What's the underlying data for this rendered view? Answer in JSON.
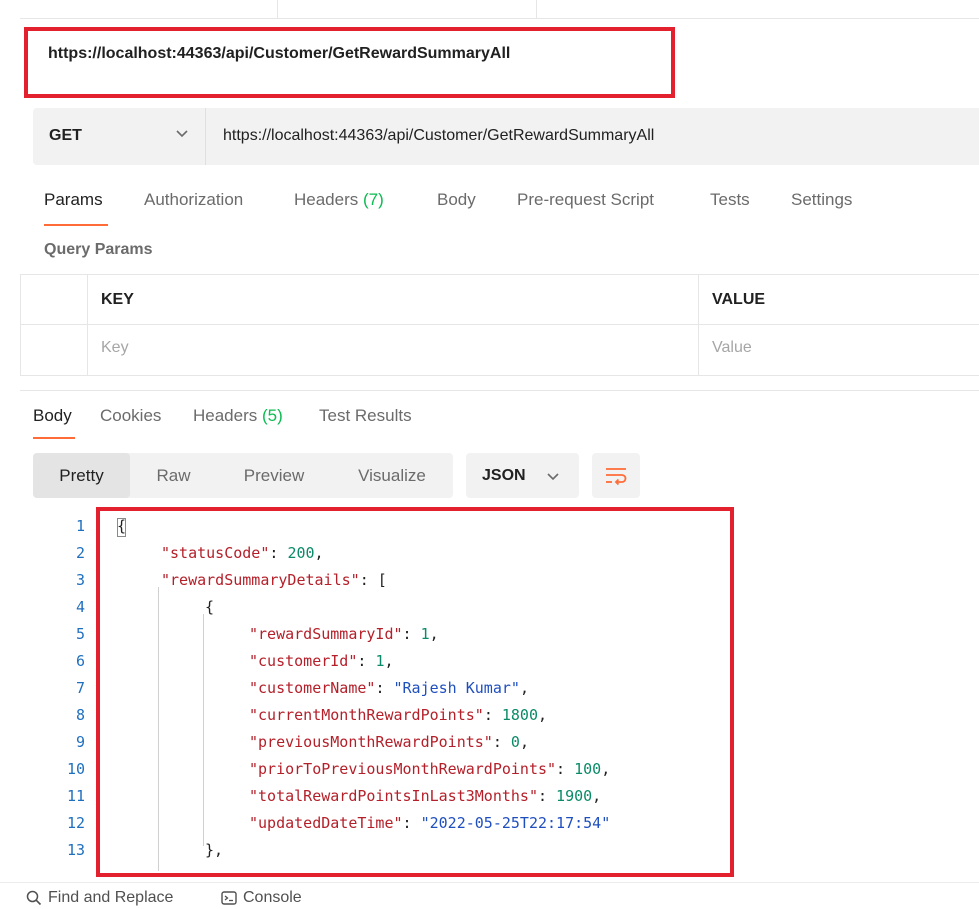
{
  "title_bar": {
    "url": "https://localhost:44363/api/Customer/GetRewardSummaryAll"
  },
  "request": {
    "method": "GET",
    "url": "https://localhost:44363/api/Customer/GetRewardSummaryAll",
    "tabs": [
      {
        "label": "Params",
        "count": ""
      },
      {
        "label": "Authorization",
        "count": ""
      },
      {
        "label": "Headers",
        "count": "(7)"
      },
      {
        "label": "Body",
        "count": ""
      },
      {
        "label": "Pre-request Script",
        "count": ""
      },
      {
        "label": "Tests",
        "count": ""
      },
      {
        "label": "Settings",
        "count": ""
      }
    ],
    "active_tab": "Params"
  },
  "query_params": {
    "title": "Query Params",
    "columns": [
      "KEY",
      "VALUE"
    ],
    "placeholder_key": "Key",
    "placeholder_value": "Value"
  },
  "response": {
    "tabs": [
      {
        "label": "Body",
        "count": ""
      },
      {
        "label": "Cookies",
        "count": ""
      },
      {
        "label": "Headers",
        "count": "(5)"
      },
      {
        "label": "Test Results",
        "count": ""
      }
    ],
    "active_tab": "Body",
    "view_modes": [
      "Pretty",
      "Raw",
      "Preview",
      "Visualize"
    ],
    "active_view_mode": "Pretty",
    "format": "JSON",
    "wrap_icon": "wrap-lines-icon"
  },
  "code_lines": [
    {
      "n": "1",
      "tokens": [
        {
          "t": "{",
          "c": "punc"
        }
      ]
    },
    {
      "n": "2",
      "tokens": [
        {
          "t": "\"statusCode\"",
          "c": "key"
        },
        {
          "t": ": ",
          "c": "punc"
        },
        {
          "t": "200",
          "c": "num"
        },
        {
          "t": ",",
          "c": "punc"
        }
      ]
    },
    {
      "n": "3",
      "tokens": [
        {
          "t": "\"rewardSummaryDetails\"",
          "c": "key"
        },
        {
          "t": ": [",
          "c": "punc"
        }
      ]
    },
    {
      "n": "4",
      "tokens": [
        {
          "t": "{",
          "c": "punc"
        }
      ]
    },
    {
      "n": "5",
      "tokens": [
        {
          "t": "\"rewardSummaryId\"",
          "c": "key"
        },
        {
          "t": ": ",
          "c": "punc"
        },
        {
          "t": "1",
          "c": "num"
        },
        {
          "t": ",",
          "c": "punc"
        }
      ]
    },
    {
      "n": "6",
      "tokens": [
        {
          "t": "\"customerId\"",
          "c": "key"
        },
        {
          "t": ": ",
          "c": "punc"
        },
        {
          "t": "1",
          "c": "num"
        },
        {
          "t": ",",
          "c": "punc"
        }
      ]
    },
    {
      "n": "7",
      "tokens": [
        {
          "t": "\"customerName\"",
          "c": "key"
        },
        {
          "t": ": ",
          "c": "punc"
        },
        {
          "t": "\"Rajesh Kumar\"",
          "c": "str"
        },
        {
          "t": ",",
          "c": "punc"
        }
      ]
    },
    {
      "n": "8",
      "tokens": [
        {
          "t": "\"currentMonthRewardPoints\"",
          "c": "key"
        },
        {
          "t": ": ",
          "c": "punc"
        },
        {
          "t": "1800",
          "c": "num"
        },
        {
          "t": ",",
          "c": "punc"
        }
      ]
    },
    {
      "n": "9",
      "tokens": [
        {
          "t": "\"previousMonthRewardPoints\"",
          "c": "key"
        },
        {
          "t": ": ",
          "c": "punc"
        },
        {
          "t": "0",
          "c": "num"
        },
        {
          "t": ",",
          "c": "punc"
        }
      ]
    },
    {
      "n": "10",
      "tokens": [
        {
          "t": "\"priorToPreviousMonthRewardPoints\"",
          "c": "key"
        },
        {
          "t": ": ",
          "c": "punc"
        },
        {
          "t": "100",
          "c": "num"
        },
        {
          "t": ",",
          "c": "punc"
        }
      ]
    },
    {
      "n": "11",
      "tokens": [
        {
          "t": "\"totalRewardPointsInLast3Months\"",
          "c": "key"
        },
        {
          "t": ": ",
          "c": "punc"
        },
        {
          "t": "1900",
          "c": "num"
        },
        {
          "t": ",",
          "c": "punc"
        }
      ]
    },
    {
      "n": "12",
      "tokens": [
        {
          "t": "\"updatedDateTime\"",
          "c": "key"
        },
        {
          "t": ": ",
          "c": "punc"
        },
        {
          "t": "\"2022-05-25T22:17:54\"",
          "c": "str"
        }
      ]
    },
    {
      "n": "13",
      "tokens": [
        {
          "t": "},",
          "c": "punc"
        }
      ]
    }
  ],
  "status_bar": {
    "find_replace": "Find and Replace",
    "console": "Console"
  },
  "colors": {
    "highlight_red": "#e3202e",
    "accent_orange": "#ff6c37",
    "count_green": "#0cbb52",
    "json_key": "#b4202a",
    "json_number": "#0a8a68",
    "json_string": "#1f4fbf"
  }
}
